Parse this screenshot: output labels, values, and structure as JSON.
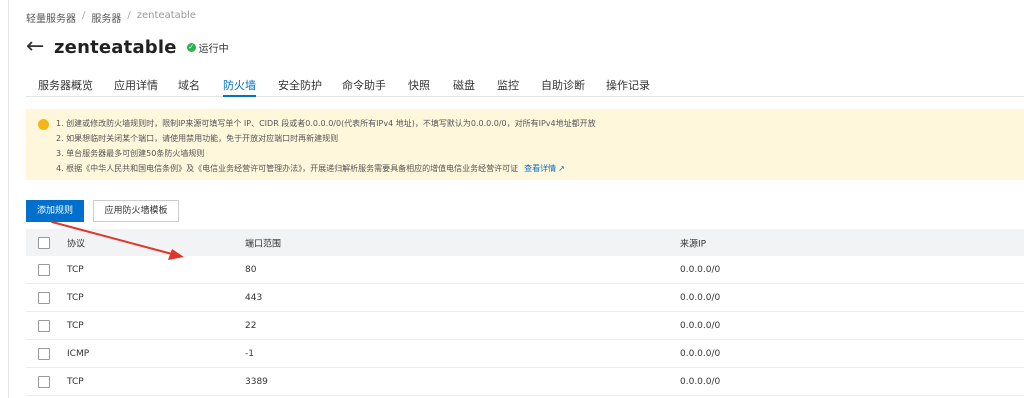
{
  "breadcrumb": {
    "item1": "轻量服务器",
    "item2": "服务器",
    "item3": "zenteatable",
    "sep": "/"
  },
  "header": {
    "back": "←",
    "title": "zenteatable",
    "status_icon": "✓",
    "status": "运行中"
  },
  "tabs": [
    "服务器概览",
    "应用详情",
    "域名",
    "防火墙",
    "安全防护",
    "命令助手",
    "快照",
    "磁盘",
    "监控",
    "自助诊断",
    "操作记录"
  ],
  "active_tab": "防火墙",
  "notice": {
    "line1": "1. 创建或修改防火墙规则时，限制IP来源可填写单个 IP、CIDR 段或者0.0.0.0/0(代表所有IPv4 地址)，不填写默认为0.0.0.0/0，对所有IPv4地址都开放",
    "line2": "2. 如果想临时关闭某个端口，请使用禁用功能，免于开放对应端口时再新建规则",
    "line3": "3. 单台服务器最多可创建50条防火墙规则",
    "line4": "4. 根据《中华人民共和国电信条例》及《电信业务经营许可管理办法》，开展递归解析服务需要具备相应的增值电信业务经营许可证",
    "link": "查看详情",
    "link_icon": "↗"
  },
  "actions": {
    "add_rule": "添加规则",
    "apply_template": "应用防火墙模板"
  },
  "table": {
    "headers": {
      "protocol": "协议",
      "port": "端口范围",
      "source": "来源IP"
    },
    "rows": [
      {
        "protocol": "TCP",
        "port": "80",
        "source": "0.0.0.0/0"
      },
      {
        "protocol": "TCP",
        "port": "443",
        "source": "0.0.0.0/0"
      },
      {
        "protocol": "TCP",
        "port": "22",
        "source": "0.0.0.0/0"
      },
      {
        "protocol": "ICMP",
        "port": "-1",
        "source": "0.0.0.0/0"
      },
      {
        "protocol": "TCP",
        "port": "3389",
        "source": "0.0.0.0/0"
      }
    ]
  },
  "colors": {
    "primary": "#0070cc",
    "notice_bg": "#fff7dc",
    "status_green": "#2bb24c",
    "annotation_red": "#e0352b"
  }
}
